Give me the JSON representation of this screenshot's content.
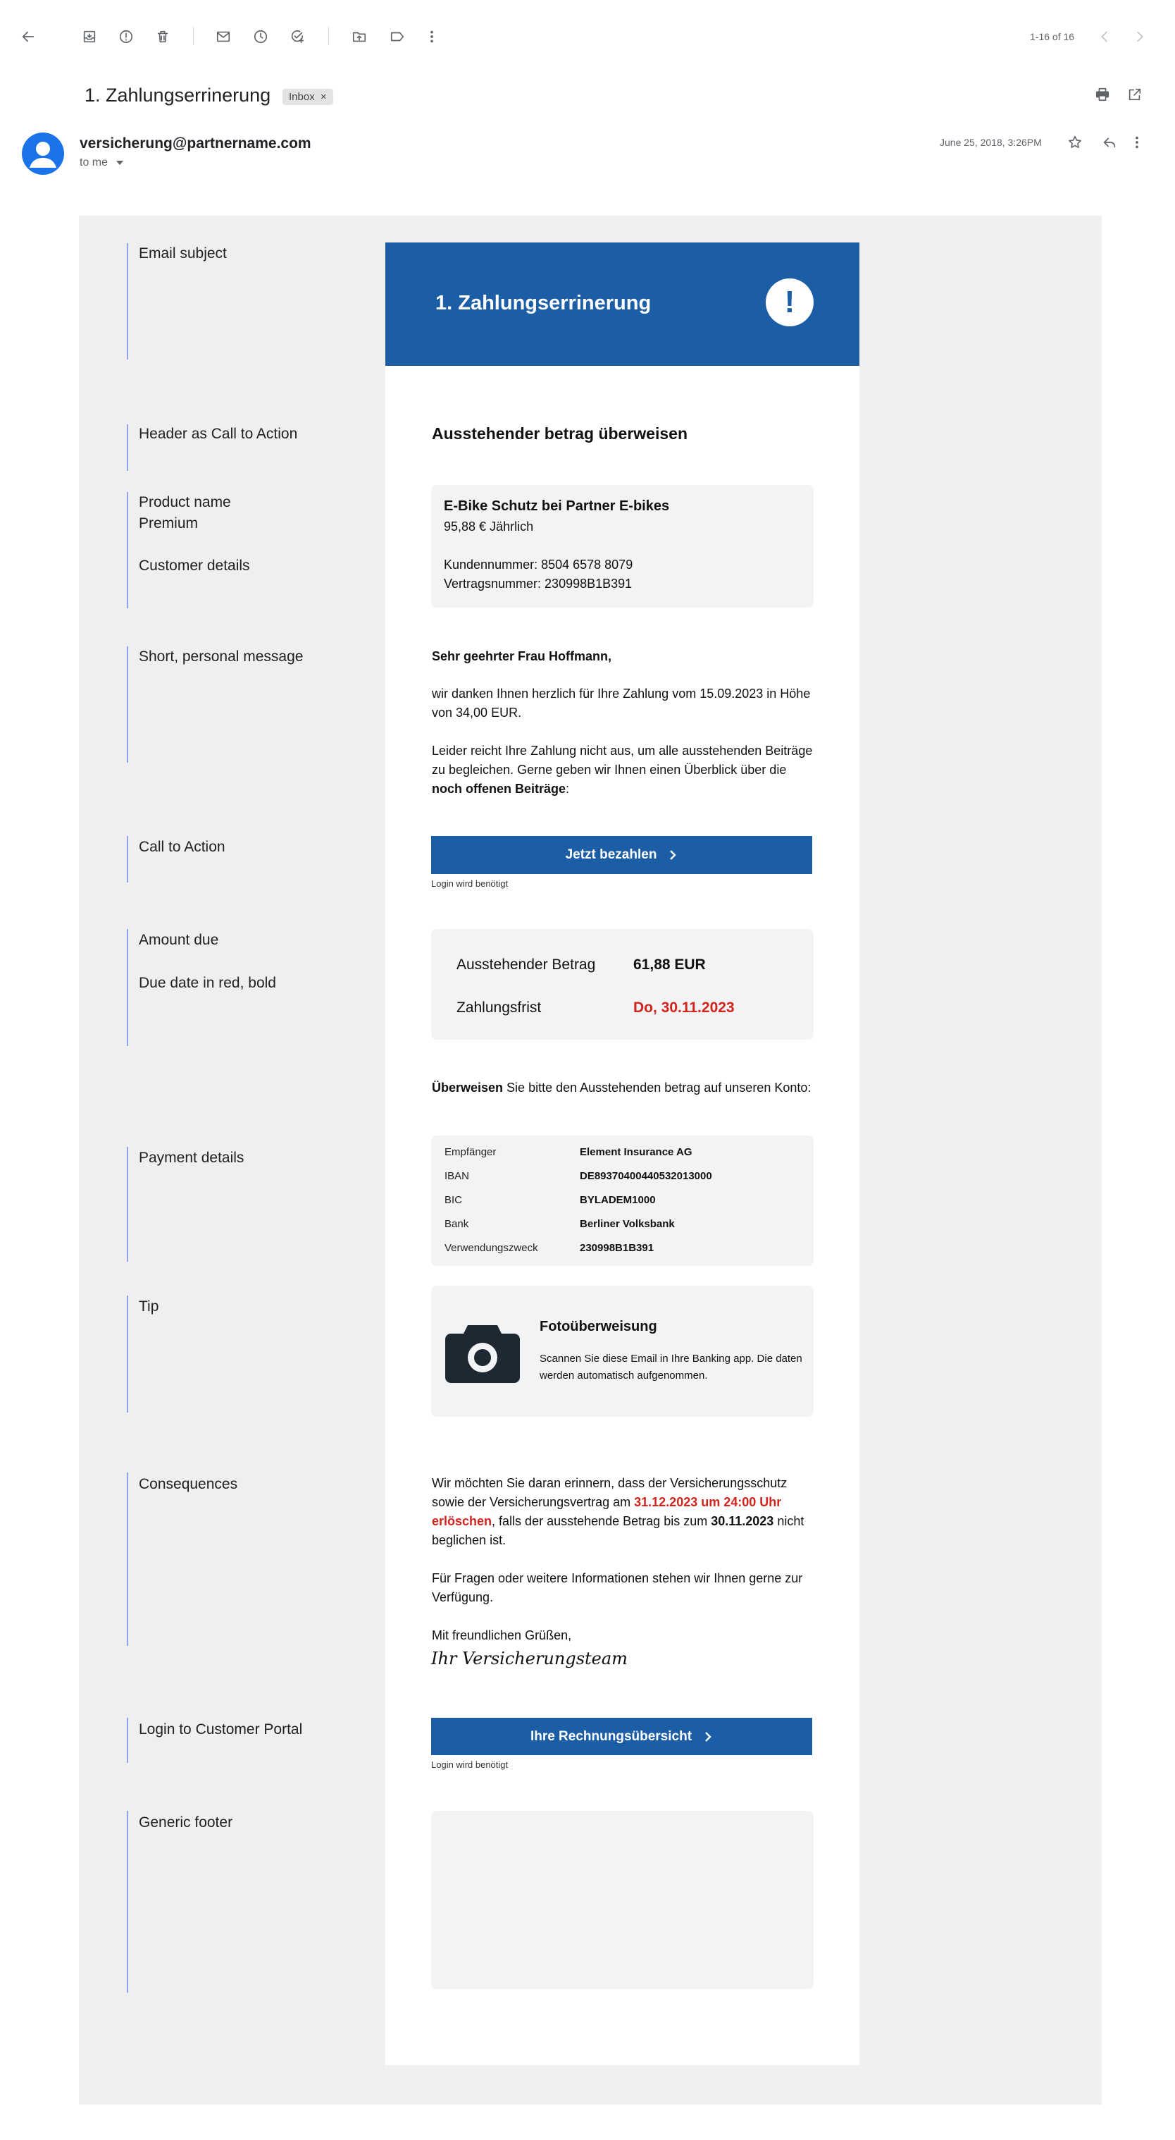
{
  "toolbar": {
    "pager": "1-16 of 16"
  },
  "message": {
    "subject": "1. Zahlungserrinerung",
    "label": "Inbox",
    "label_close": "×",
    "sender": "versicherung@partnername.com",
    "recipient": "to me",
    "date": "June 25, 2018, 3:26PM"
  },
  "annotations": {
    "email_subject": "Email subject",
    "header_cta": "Header as Call to Action",
    "product_name": "Product name",
    "premium": "Premium",
    "customer_details": "Customer details",
    "short_message": "Short, personal message",
    "cta": "Call to Action",
    "amount_due": "Amount due",
    "due_date": "Due date in red, bold",
    "payment_details": "Payment details",
    "tip": "Tip",
    "consequences": "Consequences",
    "login_portal": "Login to Customer Portal",
    "generic_footer": "Generic footer"
  },
  "email": {
    "header_title": "1. Zahlungserrinerung",
    "header_icon": "!",
    "headline": "Ausstehender betrag überweisen",
    "product": {
      "name": "E-Bike Schutz bei Partner E-bikes",
      "premium": "95,88 € Jährlich",
      "customer_number": "Kundennummer: 8504 6578 8079",
      "contract_number": "Vertragsnummer: 230998B1B391"
    },
    "greeting": "Sehr geehrter Frau Hoffmann,",
    "para1": "wir danken Ihnen herzlich für Ihre Zahlung vom 15.09.2023 in Höhe von 34,00 EUR.",
    "para2_start": "Leider reicht Ihre Zahlung nicht aus, um alle ausstehenden Beiträge zu begleichen. Gerne geben wir Ihnen einen Überblick über die ",
    "para2_bold": "noch offenen Beiträge",
    "para2_end": ":",
    "cta_label": "Jetzt bezahlen",
    "login_note": "Login wird benötigt",
    "amount_label": "Ausstehender Betrag",
    "amount_value": "61,88 EUR",
    "due_label": "Zahlungsfrist",
    "due_value": "Do, 30.11.2023",
    "transfer_bold": "Überweisen",
    "transfer_rest": " Sie bitte den Ausstehenden betrag auf unseren Konto:",
    "payment": [
      {
        "label": "Empfänger",
        "value": "Element Insurance AG"
      },
      {
        "label": "IBAN",
        "value": "DE89370400440532013000"
      },
      {
        "label": "BIC",
        "value": "BYLADEM1000"
      },
      {
        "label": "Bank",
        "value": "Berliner Volksbank"
      },
      {
        "label": "Verwendungszweck",
        "value": "230998B1B391"
      }
    ],
    "tip_title": "Fotoüberweisung",
    "tip_text": "Scannen Sie diese Email in Ihre Banking app. Die daten werden automatisch aufgenommen.",
    "cons_1": "Wir möchten Sie daran erinnern, dass der Versicherungsschutz sowie der Versicherungsvertrag am ",
    "cons_red": "31.12.2023 um 24:00 Uhr erlöschen",
    "cons_2": ", falls der ausstehende Betrag bis zum ",
    "cons_bold": "30.11.2023",
    "cons_3": " nicht beglichen ist.",
    "questions": "Für Fragen oder weitere Informationen stehen wir Ihnen gerne zur Verfügung.",
    "closing": "Mit freundlichen Grüßen,",
    "signature": "Ihr Versicherungsteam",
    "portal_label": "Ihre Rechnungsübersicht",
    "portal_note": "Login wird benötigt"
  },
  "colors": {
    "brand_blue": "#1c5ea6",
    "alert_red": "#d0241c",
    "annotation_line": "#8ea2ee",
    "box_grey": "#f2f3f5"
  },
  "icons": [
    "back-arrow-icon",
    "archive-icon",
    "report-spam-icon",
    "delete-icon",
    "mark-unread-icon",
    "snooze-icon",
    "add-task-icon",
    "move-to-icon",
    "label-icon",
    "more-vert-icon",
    "prev-chevron-icon",
    "next-chevron-icon",
    "print-icon",
    "open-new-window-icon",
    "star-icon",
    "reply-icon",
    "message-more-icon",
    "dropdown-caret-icon",
    "alert-icon",
    "camera-icon",
    "chevron-right-icon"
  ]
}
